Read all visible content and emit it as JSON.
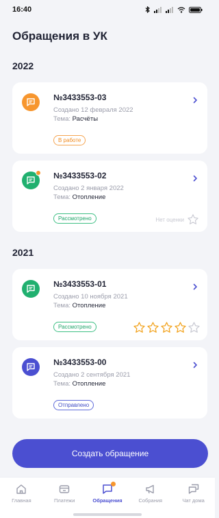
{
  "status_bar": {
    "time": "16:40"
  },
  "page": {
    "title": "Обращения в УК"
  },
  "groups": [
    {
      "year": "2022",
      "items": [
        {
          "number": "№3433553-03",
          "created": "Создано 12 февраля 2022",
          "topic_label": "Тема:",
          "topic": "Расчёты",
          "status": "В работе",
          "rating_text": ""
        },
        {
          "number": "№3433553-02",
          "created": "Создано 2 января 2022",
          "topic_label": "Тема:",
          "topic": "Отопление",
          "status": "Рассмотрено",
          "rating_text": "Нет оценки"
        }
      ]
    },
    {
      "year": "2021",
      "items": [
        {
          "number": "№3433553-01",
          "created": "Создано 10 ноября 2021",
          "topic_label": "Тема:",
          "topic": "Отопление",
          "status": "Рассмотрено",
          "rating": 4,
          "rating_max": 5
        },
        {
          "number": "№3433553-00",
          "created": "Создано 2 сентября 2021",
          "topic_label": "Тема:",
          "topic": "Отопление",
          "status": "Отправлено"
        }
      ]
    }
  ],
  "actions": {
    "create_label": "Создать обращение"
  },
  "tabbar": {
    "tabs": [
      {
        "label": "Главная",
        "icon": "home-icon"
      },
      {
        "label": "Платежи",
        "icon": "wallet-icon"
      },
      {
        "label": "Обращения",
        "icon": "chat-icon"
      },
      {
        "label": "Собрания",
        "icon": "megaphone-icon"
      },
      {
        "label": "Чат дома",
        "icon": "messages-icon"
      }
    ]
  },
  "colors": {
    "accent": "#4b4fd1",
    "orange": "#f7962e",
    "green": "#20b06f",
    "blue": "#4b4fd1",
    "star": "#f2a21c"
  }
}
